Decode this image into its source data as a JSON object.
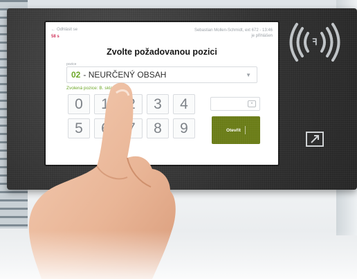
{
  "header": {
    "back_label": "Odhlásit se",
    "idle_label": "58 s",
    "user_line1": "Sebastian Mollen-Schmidt, ext 672 - 13:46",
    "user_line2": "je přihlášen"
  },
  "title": "Zvolte požadovanou pozici",
  "field": {
    "label": "pozice",
    "selected_code": "02",
    "selected_text": "- NEURČENÝ OBSAH",
    "hint": "Zvolená pozice: B. sklad"
  },
  "keypad": {
    "row1": [
      "0",
      "1",
      "2",
      "3",
      "4"
    ],
    "row2": [
      "5",
      "6",
      "7",
      "8",
      "9"
    ]
  },
  "input_clear_label": "×",
  "submit_label": "Otevřít",
  "colors": {
    "accent_green": "#6aa524",
    "submit_green": "#6a7c17",
    "alert_red": "#d0315a",
    "terminal_body": "#2f2f2f"
  },
  "icons": {
    "nfc": "contactless-nfc-icon",
    "reader": "card-slot-icon",
    "back": "arrow-left-icon",
    "dropdown": "chevron-down-icon",
    "clear": "backspace-icon"
  }
}
